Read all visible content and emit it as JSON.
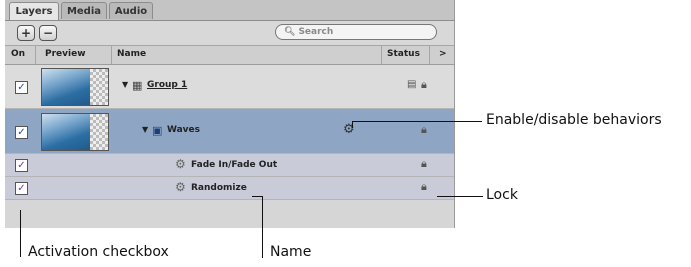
{
  "tabs": [
    "Layers",
    "Media",
    "Audio"
  ],
  "toolbar": {
    "add_label": "+",
    "remove_label": "−",
    "search_placeholder": "Search"
  },
  "columns": {
    "on": "On",
    "preview": "Preview",
    "name": "Name",
    "status": "Status",
    "more": ">"
  },
  "rows": [
    {
      "name": "Group 1",
      "checked": true
    },
    {
      "name": "Waves",
      "checked": true
    },
    {
      "name": "Fade In/Fade Out",
      "checked": true
    },
    {
      "name": "Randomize",
      "checked": true
    }
  ],
  "callouts": {
    "behaviors": "Enable/disable behaviors",
    "lock": "Lock",
    "activation": "Activation checkbox",
    "name": "Name"
  }
}
